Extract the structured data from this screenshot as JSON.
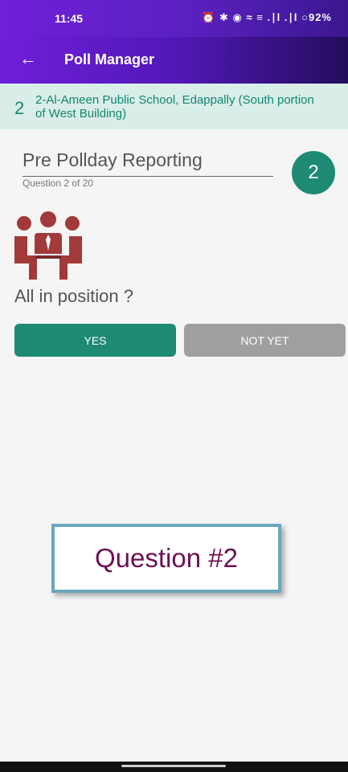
{
  "status_bar": {
    "time": "11:45",
    "icons_text": "⏰ ✱ ◉ ≈ ≡ .∣l .∣l ○92%",
    "battery": "92%"
  },
  "app_bar": {
    "back_icon": "←",
    "title": "Poll Manager"
  },
  "station": {
    "number": "2",
    "name": "2-Al-Ameen Public School, Edappally (South portion of West Building)"
  },
  "section": {
    "title": "Pre Pollday Reporting",
    "question_count": "Question 2 of 20",
    "badge": "2"
  },
  "question": {
    "icon": "people-meeting-icon",
    "text": "All in position ?"
  },
  "buttons": {
    "yes": "YES",
    "not_yet": "NOT YET"
  },
  "callout": {
    "text": "Question #2"
  },
  "colors": {
    "accent": "#1e8a74",
    "header": "#5a20c0",
    "icon": "#a23a3a"
  }
}
